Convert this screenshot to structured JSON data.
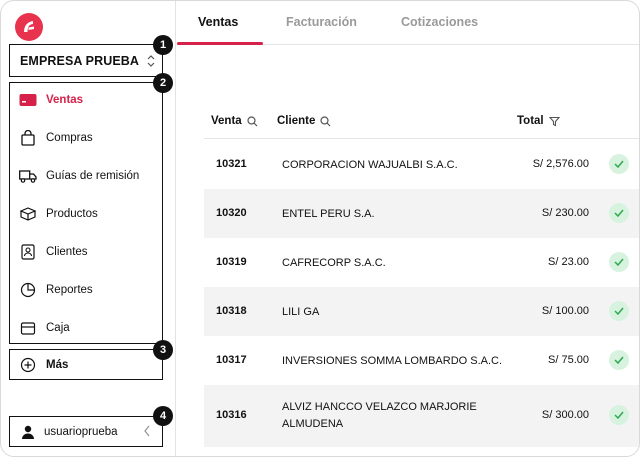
{
  "company": {
    "name": "EMPRESA PRUEBA"
  },
  "nav": {
    "items": [
      {
        "label": "Ventas",
        "icon": "card-icon",
        "active": true
      },
      {
        "label": "Compras",
        "icon": "bag-icon"
      },
      {
        "label": "Guías de remisión",
        "icon": "truck-icon"
      },
      {
        "label": "Productos",
        "icon": "box-icon"
      },
      {
        "label": "Clientes",
        "icon": "contact-icon"
      },
      {
        "label": "Reportes",
        "icon": "pie-chart-icon"
      },
      {
        "label": "Caja",
        "icon": "cashbox-icon"
      }
    ],
    "more_label": "Más"
  },
  "user": {
    "name": "usuarioprueba"
  },
  "badges": [
    "1",
    "2",
    "3",
    "4"
  ],
  "tabs": [
    {
      "label": "Ventas",
      "active": true
    },
    {
      "label": "Facturación"
    },
    {
      "label": "Cotizaciones"
    }
  ],
  "table": {
    "headers": {
      "venta": "Venta",
      "cliente": "Cliente",
      "total": "Total"
    },
    "rows": [
      {
        "venta": "10321",
        "cliente": "CORPORACION WAJUALBI S.A.C.",
        "total": "S/ 2,576.00"
      },
      {
        "venta": "10320",
        "cliente": "ENTEL PERU S.A.",
        "total": "S/ 230.00"
      },
      {
        "venta": "10319",
        "cliente": "CAFRECORP S.A.C.",
        "total": "S/ 23.00"
      },
      {
        "venta": "10318",
        "cliente": "LILI GA",
        "total": "S/ 100.00"
      },
      {
        "venta": "10317",
        "cliente": "INVERSIONES SOMMA LOMBARDO S.A.C.",
        "total": "S/ 75.00"
      },
      {
        "venta": "10316",
        "cliente": "ALVIZ HANCCO VELAZCO MARJORIE ALMUDENA",
        "total": "S/ 300.00"
      }
    ]
  },
  "colors": {
    "accent": "#d6224a",
    "brand": "#e8334f",
    "success_bg": "#d7f3df",
    "success": "#2fa84f"
  }
}
